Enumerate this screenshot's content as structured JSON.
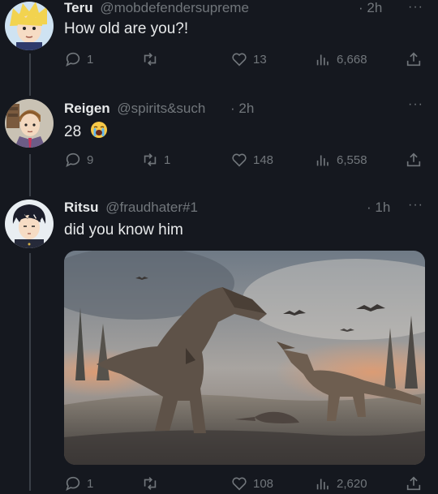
{
  "tweets": [
    {
      "name": "Teru",
      "handle": "@mobdefendersupreme",
      "time": "· 2h",
      "more": "···",
      "text": "How old are you?!",
      "replies": "1",
      "retweets": "",
      "likes": "13",
      "views": "6,668"
    },
    {
      "name": "Reigen",
      "handle": "@spirits&such",
      "time": "· 2h",
      "more": "···",
      "text": "28",
      "emoji": "loudly-crying-face",
      "replies": "9",
      "retweets": "1",
      "likes": "148",
      "views": "6,558"
    },
    {
      "name": "Ritsu",
      "handle": "@fraudhater#1",
      "time": "· 1h",
      "more": "···",
      "text": "did you know him",
      "media": "dinosaur-battle-illustration",
      "replies": "1",
      "retweets": "",
      "likes": "108",
      "views": "2,620"
    }
  ],
  "colors": {
    "background": "#15181f",
    "muted": "#71767b",
    "text": "#e7e9ea",
    "thread_line": "#3a3f47"
  },
  "icons": [
    "reply-icon",
    "retweet-icon",
    "like-icon",
    "views-icon",
    "share-icon",
    "more-icon"
  ]
}
